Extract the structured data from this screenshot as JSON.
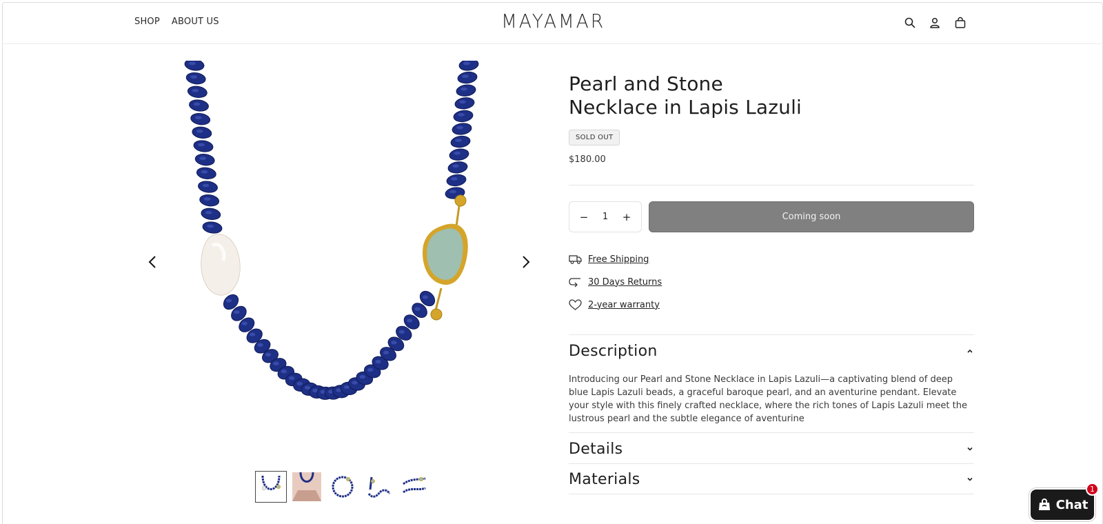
{
  "header": {
    "nav": [
      "SHOP",
      "ABOUT US"
    ],
    "logo": "MAYAMAR",
    "icons": [
      "search-icon",
      "account-icon",
      "cart-icon"
    ]
  },
  "gallery": {
    "thumbnails": 5,
    "active_thumbnail": 1
  },
  "product": {
    "title_line1": "Pearl and Stone",
    "title_line2": "Necklace in Lapis Lazuli",
    "badge": "SOLD OUT",
    "price": "$180.00",
    "quantity": "1",
    "qty_minus": "−",
    "qty_plus": "+",
    "cta": "Coming soon"
  },
  "perks": [
    {
      "icon": "truck-icon",
      "label": "Free Shipping"
    },
    {
      "icon": "return-icon",
      "label": "30 Days Returns"
    },
    {
      "icon": "heart-icon",
      "label": "2-year warranty"
    }
  ],
  "accordion": [
    {
      "title": "Description",
      "expanded": true,
      "body": "Introducing our Pearl and Stone Necklace in Lapis Lazuli—a captivating blend of deep blue Lapis Lazuli beads, a graceful baroque pearl, and an aventurine pendant. Elevate your style with this finely crafted necklace, where the rich tones of Lapis Lazuli meet the lustrous pearl and the subtle elegance of aventurine"
    },
    {
      "title": "Details",
      "expanded": false
    },
    {
      "title": "Materials",
      "expanded": false
    }
  ],
  "chat": {
    "label": "Chat",
    "badge": "1"
  },
  "colors": {
    "lapis": "#1e2f86",
    "button": "#808080",
    "gold": "#d4a52a",
    "aventurine": "#9fbfb0"
  }
}
